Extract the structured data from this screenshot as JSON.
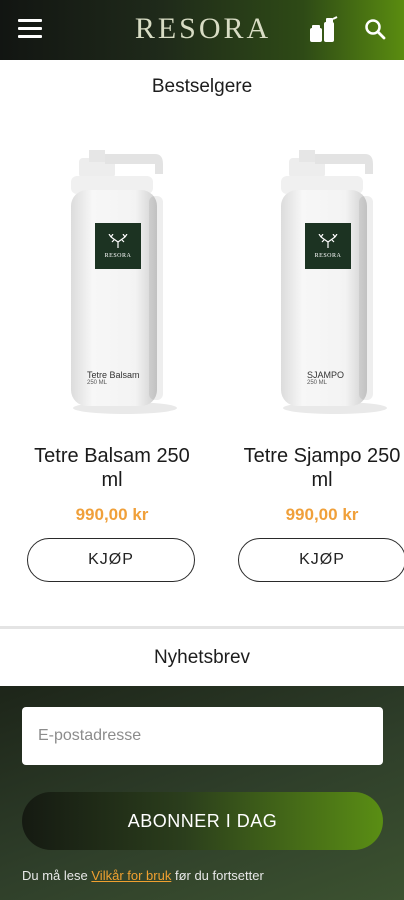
{
  "header": {
    "logo": "RESORA",
    "menu_icon": "hamburger-menu-icon",
    "cart_icon": "cart-bottles-icon",
    "search_icon": "search-icon"
  },
  "bestsellers": {
    "title": "Bestselgere",
    "products": [
      {
        "name": "Tetre Balsam 250 ml",
        "price": "990,00 kr",
        "buy_label": "KJØP",
        "bottle_brand": "RESORA",
        "bottle_label": "Tetre Balsam",
        "bottle_volume": "250 ML"
      },
      {
        "name": "Tetre Sjampo 250 ml",
        "price": "990,00 kr",
        "buy_label": "KJØP",
        "bottle_brand": "RESORA",
        "bottle_label": "SJAMPO",
        "bottle_volume": "250 ML"
      }
    ]
  },
  "newsletter": {
    "title": "Nyhetsbrev",
    "email_placeholder": "E-postadresse",
    "email_value": "",
    "subscribe_label": "ABONNER I DAG",
    "terms_prefix": "Du må lese ",
    "terms_link": "Vilkår for bruk",
    "terms_suffix": " før du fortsetter"
  },
  "colors": {
    "accent_green": "#5a8c10",
    "dark_green": "#1f2a1a",
    "price_orange": "#f0a03a",
    "label_green": "#1c3322"
  }
}
